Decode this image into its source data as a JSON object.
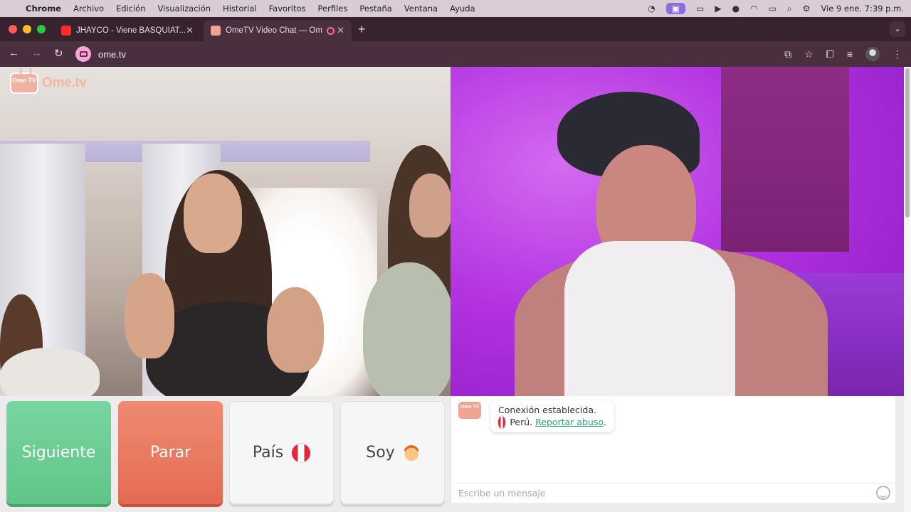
{
  "menubar": {
    "app": "Chrome",
    "items": [
      "Archivo",
      "Edición",
      "Visualización",
      "Historial",
      "Favoritos",
      "Perfiles",
      "Pestaña",
      "Ventana",
      "Ayuda"
    ],
    "clock": "Vie 9 ene.  7:39 p.m."
  },
  "tabs": [
    {
      "label": "JHAYCO - Viene BASQUIAT...",
      "close": "✕"
    },
    {
      "label": "OmeTV Video Chat — Om",
      "close": "✕"
    }
  ],
  "toolbar": {
    "url": "ome.tv"
  },
  "logo": {
    "text": "Ome.tv",
    "badge": "Ome TV"
  },
  "controls": {
    "next_label": "Siguiente",
    "stop_label": "Parar",
    "country_label": "País",
    "gender_label": "Soy"
  },
  "chat": {
    "status": "Conexión establecida.",
    "country": "Perú.",
    "report_link": "Reportar abuso",
    "report_suffix": ".",
    "input_placeholder": "Escribe un mensaje"
  },
  "colors": {
    "next": "#5fc587",
    "stop": "#e46a52",
    "link": "#2aa37a"
  }
}
